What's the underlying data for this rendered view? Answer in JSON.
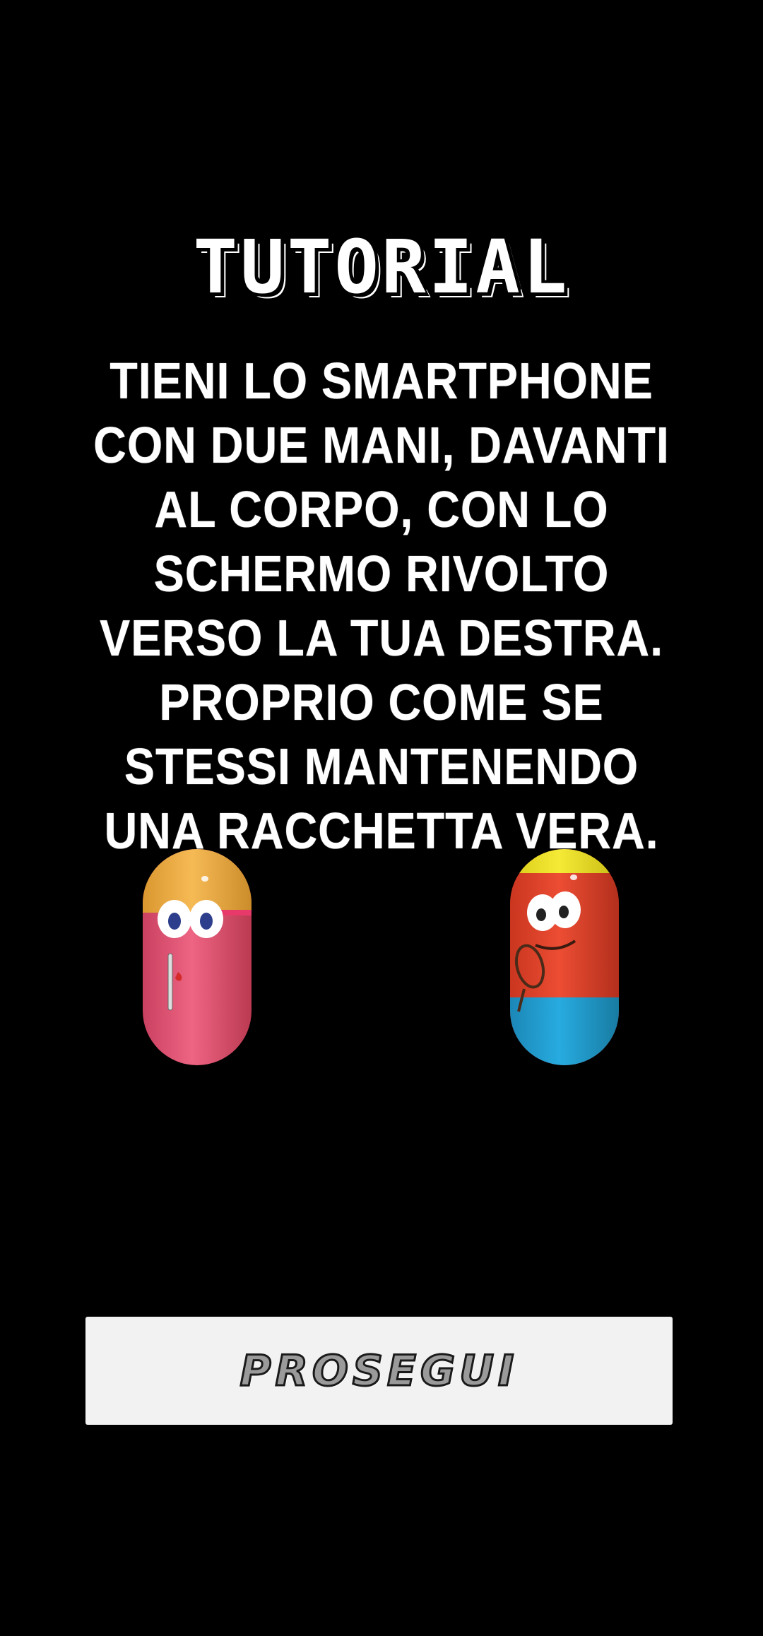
{
  "screen": {
    "title": "TUTORIAL",
    "instructions": "TIENI LO SMARTPHONE CON DUE MANI, DAVANTI AL CORPO, CON LO SCHERMO RIVOLTO VERSO LA TUA DESTRA. PROPRIO COME SE STESSI MANTENENDO UNA RACCHETTA VERA."
  },
  "characters": [
    {
      "name": "pink-pill-character",
      "colors": {
        "cap": "#F3B34B",
        "body": "#EA5B7A",
        "eyes": "#2C3E8C"
      }
    },
    {
      "name": "red-pill-character",
      "colors": {
        "cap": "#F2E72A",
        "body": "#E8472F",
        "base": "#21A3D9"
      }
    }
  ],
  "actions": {
    "continue_label": "PROSEGUI"
  },
  "colors": {
    "background": "#000000",
    "text": "#FFFFFF",
    "button_bg": "#F2F2F2"
  }
}
